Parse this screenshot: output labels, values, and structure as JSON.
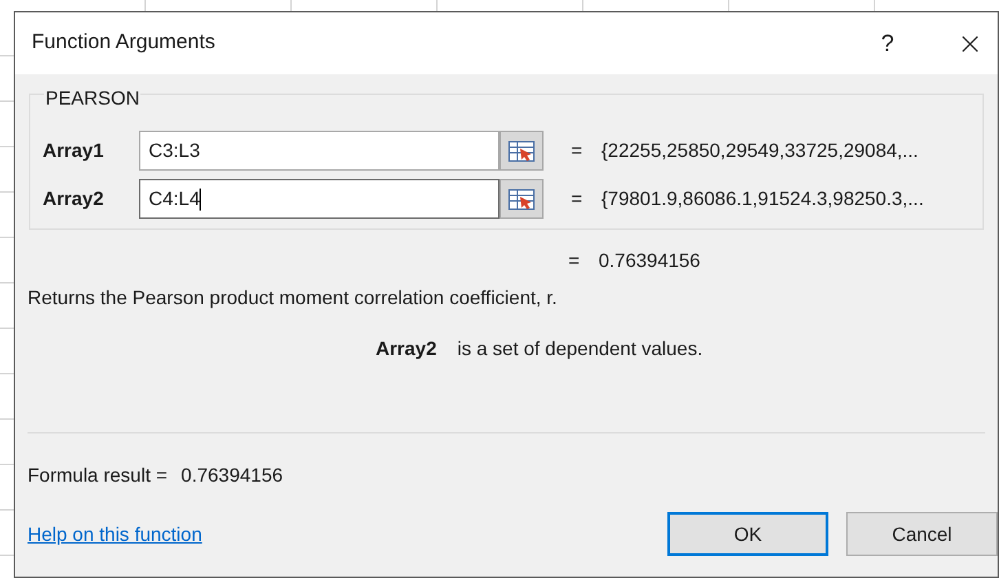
{
  "window": {
    "title": "Function Arguments",
    "help_glyph": "?"
  },
  "function_name": "PEARSON",
  "arguments": [
    {
      "label": "Array1",
      "value": "C3:L3",
      "result": "{22255,25850,29549,33725,29084,...",
      "focused": false
    },
    {
      "label": "Array2",
      "value": "C4:L4",
      "result": "{79801.9,86086.1,91524.3,98250.3,...",
      "focused": true
    }
  ],
  "equals": "=",
  "function_result": "0.76394156",
  "description": "Returns the Pearson product moment correlation coefficient, r.",
  "argument_help": {
    "name": "Array2",
    "text": "is a set of dependent values."
  },
  "formula_result": {
    "label": "Formula result =",
    "value": "0.76394156"
  },
  "help_link": "Help on this function",
  "buttons": [
    {
      "label": "OK",
      "default": true
    },
    {
      "label": "Cancel",
      "default": false
    }
  ]
}
